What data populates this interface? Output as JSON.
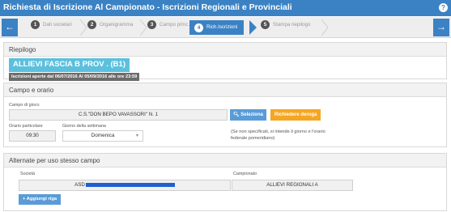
{
  "window": {
    "title": "Richiesta di Iscrizione Al Campionato - Iscrizioni Regionali e Provinciali"
  },
  "wizard": {
    "prev_icon": "arrow-left-icon",
    "next_icon": "arrow-right-icon",
    "steps": [
      {
        "num": "1",
        "label": "Dati societari",
        "active": false
      },
      {
        "num": "2",
        "label": "Organigramma",
        "active": false
      },
      {
        "num": "3",
        "label": "Campo princ.",
        "active": false
      },
      {
        "num": "4",
        "label": "Rich.Iscrizioni",
        "active": true
      },
      {
        "num": "5",
        "label": "Stampa riepilogo",
        "active": false
      }
    ]
  },
  "riepilogo": {
    "heading": "Riepilogo",
    "category": "ALLIEVI FASCIA B PROV . (B1)",
    "dates": "Iscrizioni aperte dal 06/07/2016 Al 05/09/2016 alle ore 23:59"
  },
  "campo": {
    "heading": "Campo e orario",
    "field_label": "Campo di gioco",
    "field_value": "C.S.\"DON BEPO VAVASSORI\" N. 1",
    "select_button": "Seleziona",
    "deroga_button": "Richiedere deroga",
    "time_label": "Orario particolare",
    "time_value": "09:30",
    "day_label": "Giorno della settimana",
    "day_value": "Domenica",
    "note": "(Se non specificati, si intende il giorno e l'orario federale pomeridiano)"
  },
  "alternate": {
    "heading": "Alternate per uso stesso campo",
    "col_societa": "Società",
    "col_campionato": "Campionato",
    "row": {
      "societa": "ASD",
      "campionato": "ALLIEVI REGIONALI A"
    },
    "add_button": "Aggiungi riga"
  },
  "colors": {
    "primary": "#3b82c4",
    "info": "#5bc0de",
    "warning": "#f5a623",
    "button_blue": "#5a9bd8"
  }
}
